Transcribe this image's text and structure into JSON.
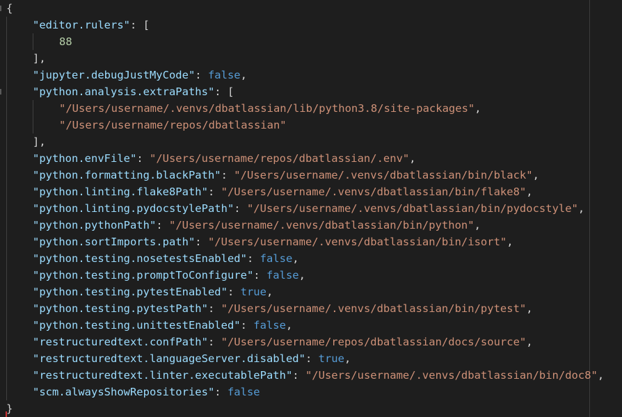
{
  "editor": {
    "open_brace": "{",
    "close_brace": "}",
    "entries": [
      {
        "key": "\"editor.rulers\"",
        "sep": ": ",
        "type": "array_open",
        "value": "["
      },
      {
        "indent": 2,
        "type": "number",
        "value": "88"
      },
      {
        "type": "array_close",
        "value": "],"
      },
      {
        "key": "\"jupyter.debugJustMyCode\"",
        "sep": ": ",
        "type": "bool",
        "value": "false",
        "trail": ","
      },
      {
        "key": "\"python.analysis.extraPaths\"",
        "sep": ": ",
        "type": "array_open",
        "value": "["
      },
      {
        "indent": 2,
        "type": "string",
        "value": "\"/Users/username/.venvs/dbatlassian/lib/python3.8/site-packages\"",
        "trail": ","
      },
      {
        "indent": 2,
        "type": "string",
        "value": "\"/Users/username/repos/dbatlassian\""
      },
      {
        "type": "array_close",
        "value": "],"
      },
      {
        "key": "\"python.envFile\"",
        "sep": ": ",
        "type": "string",
        "value": "\"/Users/username/repos/dbatlassian/.env\"",
        "trail": ","
      },
      {
        "key": "\"python.formatting.blackPath\"",
        "sep": ": ",
        "type": "string",
        "value": "\"/Users/username/.venvs/dbatlassian/bin/black\"",
        "trail": ","
      },
      {
        "key": "\"python.linting.flake8Path\"",
        "sep": ": ",
        "type": "string",
        "value": "\"/Users/username/.venvs/dbatlassian/bin/flake8\"",
        "trail": ","
      },
      {
        "key": "\"python.linting.pydocstylePath\"",
        "sep": ": ",
        "type": "string",
        "value": "\"/Users/username/.venvs/dbatlassian/bin/pydocstyle\"",
        "trail": ","
      },
      {
        "key": "\"python.pythonPath\"",
        "sep": ": ",
        "type": "string",
        "value": "\"/Users/username/.venvs/dbatlassian/bin/python\"",
        "trail": ","
      },
      {
        "key": "\"python.sortImports.path\"",
        "sep": ": ",
        "type": "string",
        "value": "\"/Users/username/.venvs/dbatlassian/bin/isort\"",
        "trail": ","
      },
      {
        "key": "\"python.testing.nosetestsEnabled\"",
        "sep": ": ",
        "type": "bool",
        "value": "false",
        "trail": ","
      },
      {
        "key": "\"python.testing.promptToConfigure\"",
        "sep": ": ",
        "type": "bool",
        "value": "false",
        "trail": ","
      },
      {
        "key": "\"python.testing.pytestEnabled\"",
        "sep": ": ",
        "type": "bool",
        "value": "true",
        "trail": ","
      },
      {
        "key": "\"python.testing.pytestPath\"",
        "sep": ": ",
        "type": "string",
        "value": "\"/Users/username/.venvs/dbatlassian/bin/pytest\"",
        "trail": ","
      },
      {
        "key": "\"python.testing.unittestEnabled\"",
        "sep": ": ",
        "type": "bool",
        "value": "false",
        "trail": ","
      },
      {
        "key": "\"restructuredtext.confPath\"",
        "sep": ": ",
        "type": "string",
        "value": "\"/Users/username/repos/dbatlassian/docs/source\"",
        "trail": ","
      },
      {
        "key": "\"restructuredtext.languageServer.disabled\"",
        "sep": ": ",
        "type": "bool",
        "value": "true",
        "trail": ","
      },
      {
        "key": "\"restructuredtext.linter.executablePath\"",
        "sep": ": ",
        "type": "string",
        "value": "\"/Users/username/.venvs/dbatlassian/bin/doc8\"",
        "trail": ","
      },
      {
        "key": "\"scm.alwaysShowRepositories\"",
        "sep": ": ",
        "type": "bool",
        "value": "false"
      }
    ]
  },
  "colors": {
    "background": "#1e1e1e",
    "key": "#9cdcfe",
    "string": "#ce9178",
    "number": "#b5cea8",
    "boolean": "#569cd6",
    "punctuation": "#d4d4d4"
  }
}
